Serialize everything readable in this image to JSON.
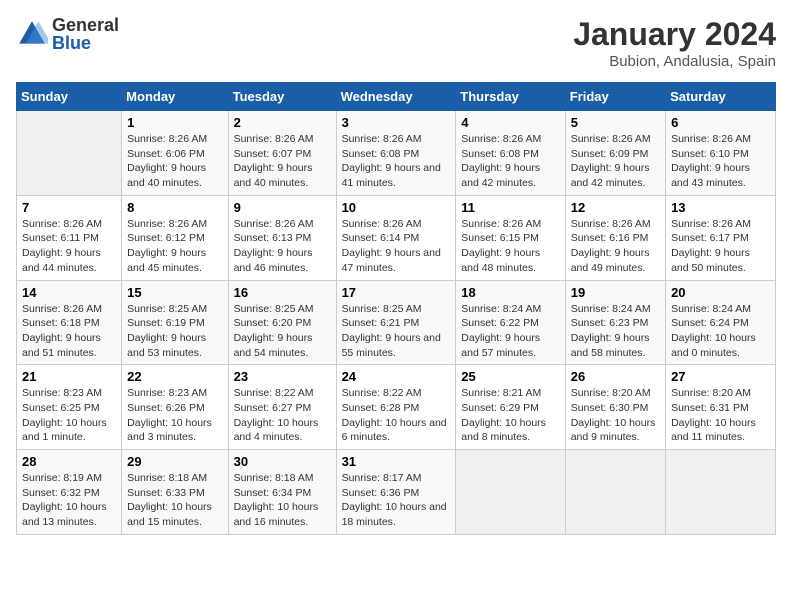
{
  "header": {
    "logo_general": "General",
    "logo_blue": "Blue",
    "month_title": "January 2024",
    "location": "Bubion, Andalusia, Spain"
  },
  "weekdays": [
    "Sunday",
    "Monday",
    "Tuesday",
    "Wednesday",
    "Thursday",
    "Friday",
    "Saturday"
  ],
  "weeks": [
    [
      {
        "day": "",
        "sunrise": "",
        "sunset": "",
        "daylight": ""
      },
      {
        "day": "1",
        "sunrise": "Sunrise: 8:26 AM",
        "sunset": "Sunset: 6:06 PM",
        "daylight": "Daylight: 9 hours and 40 minutes."
      },
      {
        "day": "2",
        "sunrise": "Sunrise: 8:26 AM",
        "sunset": "Sunset: 6:07 PM",
        "daylight": "Daylight: 9 hours and 40 minutes."
      },
      {
        "day": "3",
        "sunrise": "Sunrise: 8:26 AM",
        "sunset": "Sunset: 6:08 PM",
        "daylight": "Daylight: 9 hours and 41 minutes."
      },
      {
        "day": "4",
        "sunrise": "Sunrise: 8:26 AM",
        "sunset": "Sunset: 6:08 PM",
        "daylight": "Daylight: 9 hours and 42 minutes."
      },
      {
        "day": "5",
        "sunrise": "Sunrise: 8:26 AM",
        "sunset": "Sunset: 6:09 PM",
        "daylight": "Daylight: 9 hours and 42 minutes."
      },
      {
        "day": "6",
        "sunrise": "Sunrise: 8:26 AM",
        "sunset": "Sunset: 6:10 PM",
        "daylight": "Daylight: 9 hours and 43 minutes."
      }
    ],
    [
      {
        "day": "7",
        "sunrise": "Sunrise: 8:26 AM",
        "sunset": "Sunset: 6:11 PM",
        "daylight": "Daylight: 9 hours and 44 minutes."
      },
      {
        "day": "8",
        "sunrise": "Sunrise: 8:26 AM",
        "sunset": "Sunset: 6:12 PM",
        "daylight": "Daylight: 9 hours and 45 minutes."
      },
      {
        "day": "9",
        "sunrise": "Sunrise: 8:26 AM",
        "sunset": "Sunset: 6:13 PM",
        "daylight": "Daylight: 9 hours and 46 minutes."
      },
      {
        "day": "10",
        "sunrise": "Sunrise: 8:26 AM",
        "sunset": "Sunset: 6:14 PM",
        "daylight": "Daylight: 9 hours and 47 minutes."
      },
      {
        "day": "11",
        "sunrise": "Sunrise: 8:26 AM",
        "sunset": "Sunset: 6:15 PM",
        "daylight": "Daylight: 9 hours and 48 minutes."
      },
      {
        "day": "12",
        "sunrise": "Sunrise: 8:26 AM",
        "sunset": "Sunset: 6:16 PM",
        "daylight": "Daylight: 9 hours and 49 minutes."
      },
      {
        "day": "13",
        "sunrise": "Sunrise: 8:26 AM",
        "sunset": "Sunset: 6:17 PM",
        "daylight": "Daylight: 9 hours and 50 minutes."
      }
    ],
    [
      {
        "day": "14",
        "sunrise": "Sunrise: 8:26 AM",
        "sunset": "Sunset: 6:18 PM",
        "daylight": "Daylight: 9 hours and 51 minutes."
      },
      {
        "day": "15",
        "sunrise": "Sunrise: 8:25 AM",
        "sunset": "Sunset: 6:19 PM",
        "daylight": "Daylight: 9 hours and 53 minutes."
      },
      {
        "day": "16",
        "sunrise": "Sunrise: 8:25 AM",
        "sunset": "Sunset: 6:20 PM",
        "daylight": "Daylight: 9 hours and 54 minutes."
      },
      {
        "day": "17",
        "sunrise": "Sunrise: 8:25 AM",
        "sunset": "Sunset: 6:21 PM",
        "daylight": "Daylight: 9 hours and 55 minutes."
      },
      {
        "day": "18",
        "sunrise": "Sunrise: 8:24 AM",
        "sunset": "Sunset: 6:22 PM",
        "daylight": "Daylight: 9 hours and 57 minutes."
      },
      {
        "day": "19",
        "sunrise": "Sunrise: 8:24 AM",
        "sunset": "Sunset: 6:23 PM",
        "daylight": "Daylight: 9 hours and 58 minutes."
      },
      {
        "day": "20",
        "sunrise": "Sunrise: 8:24 AM",
        "sunset": "Sunset: 6:24 PM",
        "daylight": "Daylight: 10 hours and 0 minutes."
      }
    ],
    [
      {
        "day": "21",
        "sunrise": "Sunrise: 8:23 AM",
        "sunset": "Sunset: 6:25 PM",
        "daylight": "Daylight: 10 hours and 1 minute."
      },
      {
        "day": "22",
        "sunrise": "Sunrise: 8:23 AM",
        "sunset": "Sunset: 6:26 PM",
        "daylight": "Daylight: 10 hours and 3 minutes."
      },
      {
        "day": "23",
        "sunrise": "Sunrise: 8:22 AM",
        "sunset": "Sunset: 6:27 PM",
        "daylight": "Daylight: 10 hours and 4 minutes."
      },
      {
        "day": "24",
        "sunrise": "Sunrise: 8:22 AM",
        "sunset": "Sunset: 6:28 PM",
        "daylight": "Daylight: 10 hours and 6 minutes."
      },
      {
        "day": "25",
        "sunrise": "Sunrise: 8:21 AM",
        "sunset": "Sunset: 6:29 PM",
        "daylight": "Daylight: 10 hours and 8 minutes."
      },
      {
        "day": "26",
        "sunrise": "Sunrise: 8:20 AM",
        "sunset": "Sunset: 6:30 PM",
        "daylight": "Daylight: 10 hours and 9 minutes."
      },
      {
        "day": "27",
        "sunrise": "Sunrise: 8:20 AM",
        "sunset": "Sunset: 6:31 PM",
        "daylight": "Daylight: 10 hours and 11 minutes."
      }
    ],
    [
      {
        "day": "28",
        "sunrise": "Sunrise: 8:19 AM",
        "sunset": "Sunset: 6:32 PM",
        "daylight": "Daylight: 10 hours and 13 minutes."
      },
      {
        "day": "29",
        "sunrise": "Sunrise: 8:18 AM",
        "sunset": "Sunset: 6:33 PM",
        "daylight": "Daylight: 10 hours and 15 minutes."
      },
      {
        "day": "30",
        "sunrise": "Sunrise: 8:18 AM",
        "sunset": "Sunset: 6:34 PM",
        "daylight": "Daylight: 10 hours and 16 minutes."
      },
      {
        "day": "31",
        "sunrise": "Sunrise: 8:17 AM",
        "sunset": "Sunset: 6:36 PM",
        "daylight": "Daylight: 10 hours and 18 minutes."
      },
      {
        "day": "",
        "sunrise": "",
        "sunset": "",
        "daylight": ""
      },
      {
        "day": "",
        "sunrise": "",
        "sunset": "",
        "daylight": ""
      },
      {
        "day": "",
        "sunrise": "",
        "sunset": "",
        "daylight": ""
      }
    ]
  ]
}
